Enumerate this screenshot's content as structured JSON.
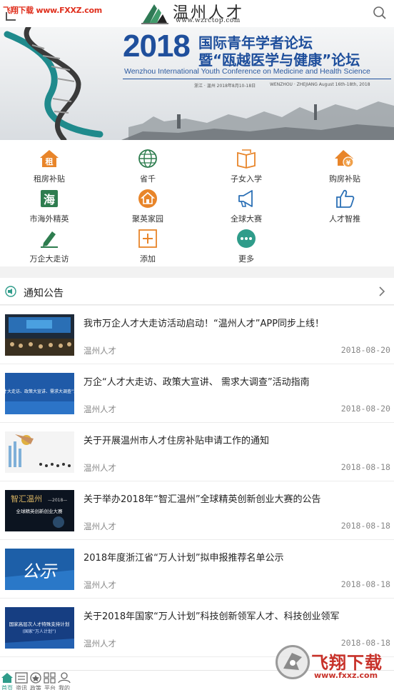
{
  "watermark_top": "飞翔下载 www.FXXZ.com",
  "header": {
    "logo_text": "温州人才",
    "logo_url": "www.wzrctop.com"
  },
  "banner": {
    "year": "2018",
    "title_line1": "国际青年学者论坛",
    "title_line2": "暨“瓯越医学与健康”论坛",
    "subtitle": "Wenzhou International Youth Conference on Medicine and Health Science",
    "meta_cn": "浙江 · 温州    2018年8月10-18日",
    "meta_en": "WENZHOU · ZHEJIANG   August 16th-18th, 2018"
  },
  "grid": [
    {
      "label": "租房补贴",
      "icon": "house-rent-icon"
    },
    {
      "label": "省千",
      "icon": "globe-icon"
    },
    {
      "label": "子女入学",
      "icon": "book-icon"
    },
    {
      "label": "购房补贴",
      "icon": "house-yen-icon"
    },
    {
      "label": "市海外精英",
      "icon": "sea-icon"
    },
    {
      "label": "聚英家园",
      "icon": "home-circle-icon"
    },
    {
      "label": "全球大赛",
      "icon": "megaphone-icon"
    },
    {
      "label": "人才智推",
      "icon": "thumbs-up-icon"
    },
    {
      "label": "万企大走访",
      "icon": "pen-icon"
    },
    {
      "label": "添加",
      "icon": "add-icon"
    },
    {
      "label": "更多",
      "icon": "more-icon"
    }
  ],
  "section": {
    "title": "通知公告"
  },
  "news": [
    {
      "title": "我市万企人才大走访活动启动！“温州人才”APP同步上线！",
      "source": "温州人才",
      "date": "2018-08-20"
    },
    {
      "title": "万企“人才大走访、政策大宣讲、 需求大调查”活动指南",
      "source": "温州人才",
      "date": "2018-08-20"
    },
    {
      "title": "关于开展温州市人才住房补贴申请工作的通知",
      "source": "温州人才",
      "date": "2018-08-18"
    },
    {
      "title": "关于举办2018年“智汇温州”全球精英创新创业大赛的公告",
      "source": "温州人才",
      "date": "2018-08-18"
    },
    {
      "title": "2018年度浙江省“万人计划”拟申报推荐名单公示",
      "source": "温州人才",
      "date": "2018-08-18"
    },
    {
      "title": "关于2018年国家“万人计划”科技创新领军人才、科技创业领军",
      "source": "温州人才",
      "date": "2018-08-18"
    }
  ],
  "thumbs": {
    "t2": "万企“人才大走访、政策大宣讲、需求大调查”活动指南",
    "t4a": "智汇温州",
    "t4b": "—2018—",
    "t4c": "全球精英创新创业大赛",
    "t5": "公示",
    "t6a": "国家高层次人才特殊支持计划",
    "t6b": "(国家“万人计划”)"
  },
  "tabbar": [
    {
      "label": "首页",
      "icon": "home-icon"
    },
    {
      "label": "资讯",
      "icon": "news-icon"
    },
    {
      "label": "政策",
      "icon": "policy-icon"
    },
    {
      "label": "平台",
      "icon": "platform-icon"
    },
    {
      "label": "我的",
      "icon": "user-icon"
    }
  ],
  "watermark_br": {
    "text": "飞翔下载",
    "url": "www.fxxz.com"
  },
  "colors": {
    "accent": "#2f9c8a",
    "orange": "#e8852a",
    "banner_blue": "#1f4f9c"
  }
}
